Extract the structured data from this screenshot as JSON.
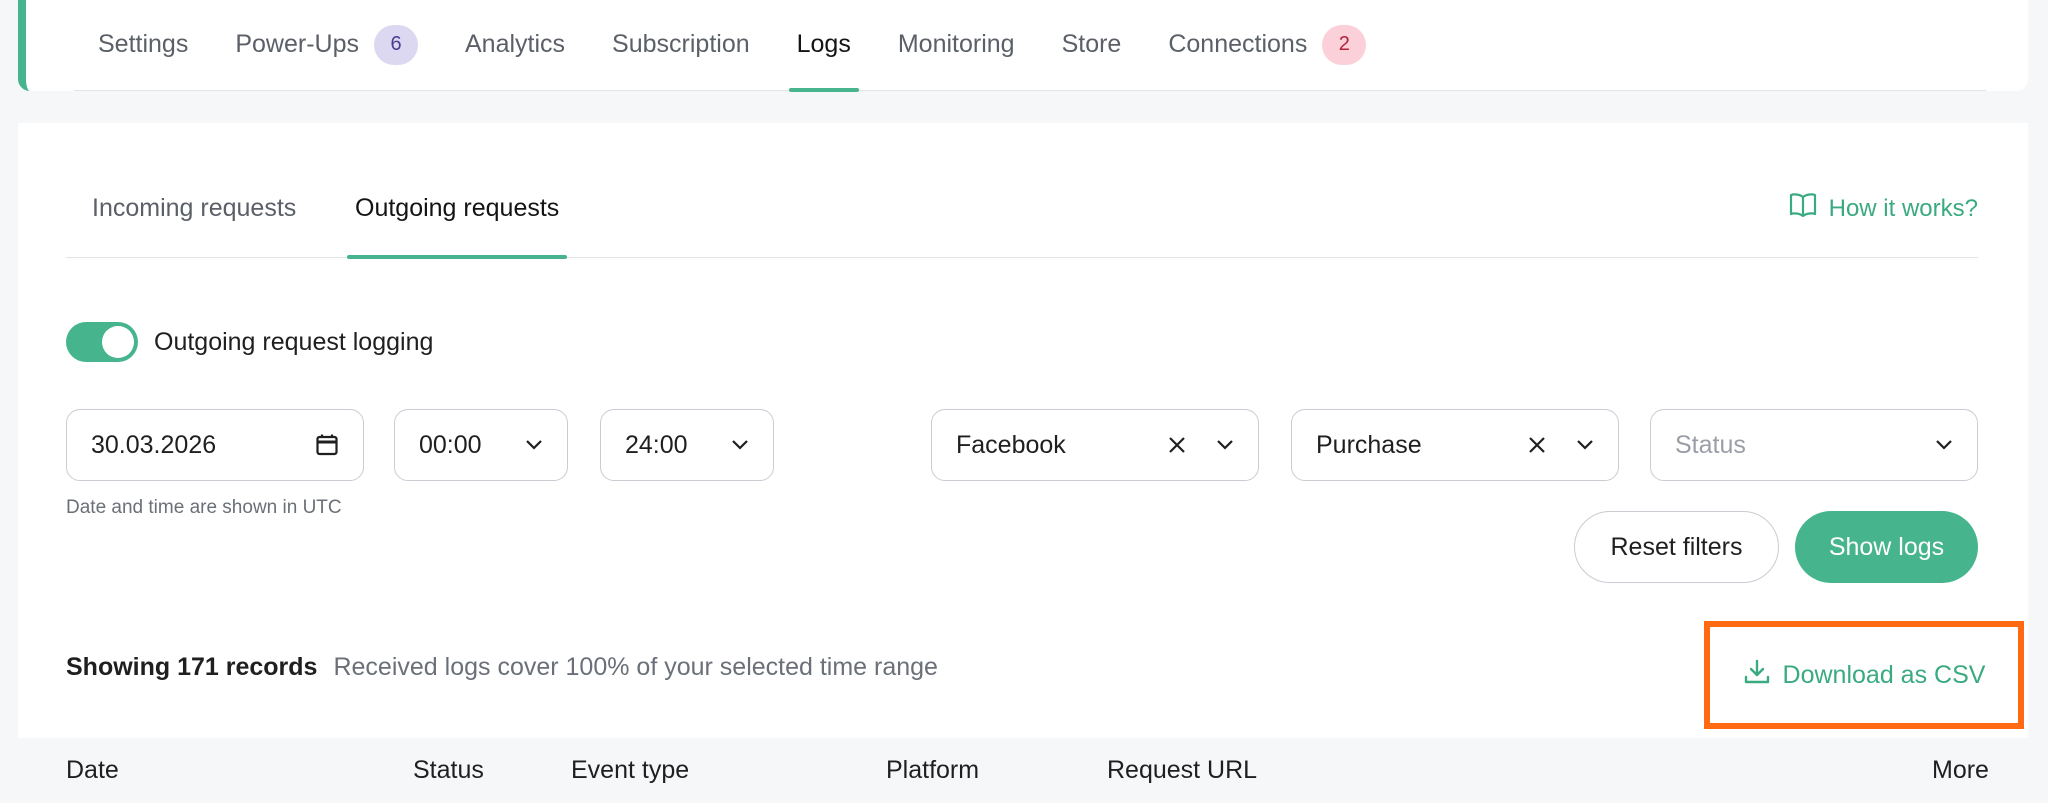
{
  "main_tabs": [
    {
      "label": "Settings"
    },
    {
      "label": "Power-Ups",
      "badge": "6"
    },
    {
      "label": "Analytics"
    },
    {
      "label": "Subscription"
    },
    {
      "label": "Logs",
      "active": true
    },
    {
      "label": "Monitoring"
    },
    {
      "label": "Store"
    },
    {
      "label": "Connections",
      "badge": "2"
    }
  ],
  "sub_tabs": {
    "incoming": "Incoming requests",
    "outgoing": "Outgoing requests",
    "active": "outgoing"
  },
  "how_it_works": "How it works?",
  "toggle": {
    "label": "Outgoing request logging",
    "on": true
  },
  "filters": {
    "date": "30.03.2026",
    "time_from": "00:00",
    "time_to": "24:00",
    "platform": "Facebook",
    "event": "Purchase",
    "status_placeholder": "Status"
  },
  "hint": "Date and time are shown in UTC",
  "buttons": {
    "reset": "Reset filters",
    "show": "Show logs"
  },
  "summary": {
    "count": "Showing 171 records",
    "coverage": "Received logs cover 100% of your selected time range"
  },
  "download": "Download as CSV",
  "table_headers": {
    "date": "Date",
    "status": "Status",
    "event_type": "Event type",
    "platform": "Platform",
    "request_url": "Request URL",
    "more": "More"
  },
  "colors": {
    "accent": "#46b48c",
    "highlight": "#ff6a13"
  }
}
